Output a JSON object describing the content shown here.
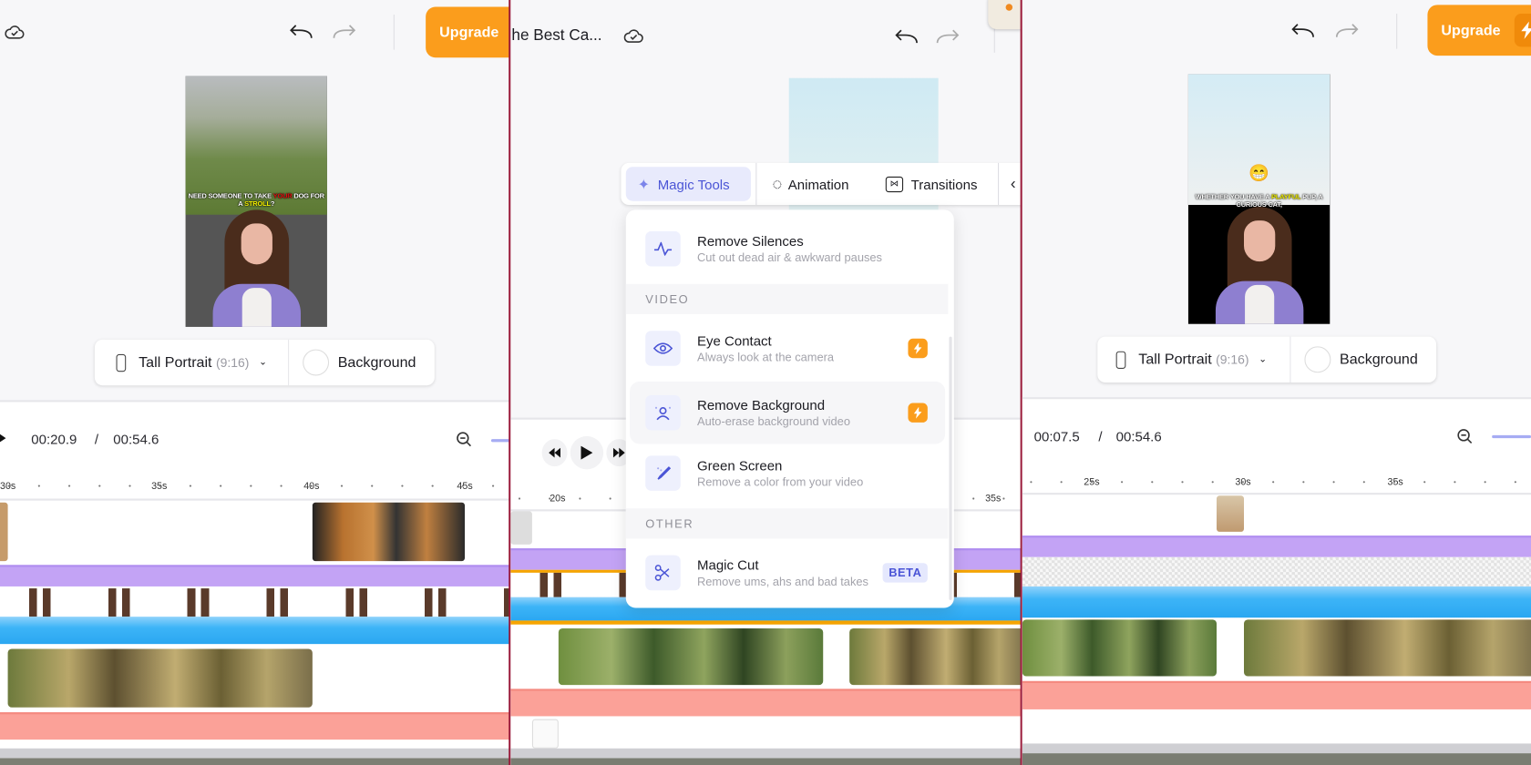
{
  "colors": {
    "accent": "#4b55d6",
    "upgrade": "#fb9d1c",
    "purple_track": "#c3a3f5",
    "audio_track": "#3db4f7",
    "salmon_track": "#fba198",
    "panel_divider": "#9a1a3a"
  },
  "panels": [
    {
      "upgrade_label": "Upgrade",
      "preview_caption": [
        "NEED SOMEONE TO TAKE ",
        "YOUR",
        " DOG FOR ",
        "A ",
        "STROLL",
        "?"
      ],
      "format": {
        "label": "Tall Portrait",
        "ratio": "(9:16)",
        "background_label": "Background"
      },
      "time": {
        "current": "00:20.9",
        "sep": "/",
        "total": "00:54.6"
      },
      "ruler": [
        "30s",
        "35s",
        "40s",
        "45s"
      ]
    },
    {
      "project_title": "he Best Ca...",
      "toolbar": {
        "tabs": [
          {
            "label": "Magic Tools",
            "icon": "sparkles-icon",
            "active": true
          },
          {
            "label": "Animation",
            "icon": "animation-icon"
          },
          {
            "label": "Transitions",
            "icon": "transitions-icon"
          }
        ]
      },
      "menu": {
        "items_top": [
          {
            "title": "Remove Silences",
            "subtitle": "Cut out dead air & awkward pauses",
            "icon": "waveform-icon"
          }
        ],
        "sections": [
          {
            "label": "VIDEO",
            "items": [
              {
                "title": "Eye Contact",
                "subtitle": "Always look at the camera",
                "icon": "eye-icon",
                "premium": true
              },
              {
                "title": "Remove Background",
                "subtitle": "Auto-erase background video",
                "icon": "person-remove-icon",
                "premium": true,
                "hovered": true
              },
              {
                "title": "Green Screen",
                "subtitle": "Remove a color from your video",
                "icon": "eyedropper-icon"
              }
            ]
          },
          {
            "label": "OTHER",
            "items": [
              {
                "title": "Magic Cut",
                "subtitle": "Remove ums, ahs and bad takes",
                "icon": "scissors-sparkle-icon",
                "badge": "BETA"
              }
            ]
          }
        ]
      },
      "ruler": [
        "20s",
        "35s"
      ]
    },
    {
      "upgrade_label": "Upgrade",
      "preview_caption": [
        "WHETHER YOU HAVE A ",
        "PLAYFUL",
        " PUP, A ",
        "CURIOUS CAT,"
      ],
      "preview_emoji": "😁",
      "format": {
        "label": "Tall Portrait",
        "ratio": "(9:16)",
        "background_label": "Background"
      },
      "time": {
        "current": "00:07.5",
        "sep": "/",
        "total": "00:54.6"
      },
      "ruler": [
        "25s",
        "30s",
        "35s"
      ]
    }
  ]
}
